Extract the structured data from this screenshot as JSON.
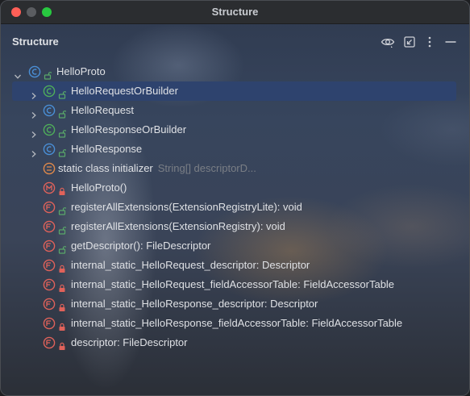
{
  "window": {
    "title": "Structure"
  },
  "panel": {
    "title": "Structure"
  },
  "header_icons": [
    "eye-icon",
    "collapse-icon",
    "more-icon",
    "minimize-icon"
  ],
  "tree": {
    "root": {
      "label": "HelloProto",
      "kind": "class",
      "visibility": "public",
      "expanded": true
    },
    "items": [
      {
        "label": "HelloRequestOrBuilder",
        "hint": "",
        "kind": "interface",
        "visibility": "public",
        "expandable": true,
        "selected": true
      },
      {
        "label": "HelloRequest",
        "hint": "",
        "kind": "class",
        "visibility": "public",
        "expandable": true
      },
      {
        "label": "HelloResponseOrBuilder",
        "hint": "",
        "kind": "interface",
        "visibility": "public",
        "expandable": true
      },
      {
        "label": "HelloResponse",
        "hint": "",
        "kind": "class",
        "visibility": "public",
        "expandable": true
      },
      {
        "label": "static class initializer",
        "hint": "String[] descriptorD...",
        "kind": "initializer",
        "visibility": "none",
        "expandable": false
      },
      {
        "label": "HelloProto()",
        "hint": "",
        "kind": "constructor",
        "visibility": "private",
        "expandable": false
      },
      {
        "label": "registerAllExtensions(ExtensionRegistryLite): void",
        "hint": "",
        "kind": "method",
        "visibility": "public",
        "expandable": false
      },
      {
        "label": "registerAllExtensions(ExtensionRegistry): void",
        "hint": "",
        "kind": "method",
        "visibility": "public",
        "expandable": false
      },
      {
        "label": "getDescriptor(): FileDescriptor",
        "hint": "",
        "kind": "method",
        "visibility": "public",
        "expandable": false
      },
      {
        "label": "internal_static_HelloRequest_descriptor: Descriptor",
        "hint": "",
        "kind": "field",
        "visibility": "private",
        "expandable": false
      },
      {
        "label": "internal_static_HelloRequest_fieldAccessorTable: FieldAccessorTable",
        "hint": "",
        "kind": "field",
        "visibility": "private",
        "expandable": false
      },
      {
        "label": "internal_static_HelloResponse_descriptor: Descriptor",
        "hint": "",
        "kind": "field",
        "visibility": "private",
        "expandable": false
      },
      {
        "label": "internal_static_HelloResponse_fieldAccessorTable: FieldAccessorTable",
        "hint": "",
        "kind": "field",
        "visibility": "private",
        "expandable": false
      },
      {
        "label": "descriptor: FileDescriptor",
        "hint": "",
        "kind": "field",
        "visibility": "private",
        "expandable": false
      }
    ]
  },
  "colors": {
    "selection": "#2e436e",
    "class_icon": "#4a8fd6",
    "interface_icon": "#4fae5a",
    "method_icon": "#e0625a",
    "field_icon": "#e0625a",
    "initializer_icon": "#e0894a",
    "public_vis": "#59a869",
    "private_vis": "#e0625a",
    "text": "#dfe1e5",
    "hint": "#7a7e85"
  }
}
